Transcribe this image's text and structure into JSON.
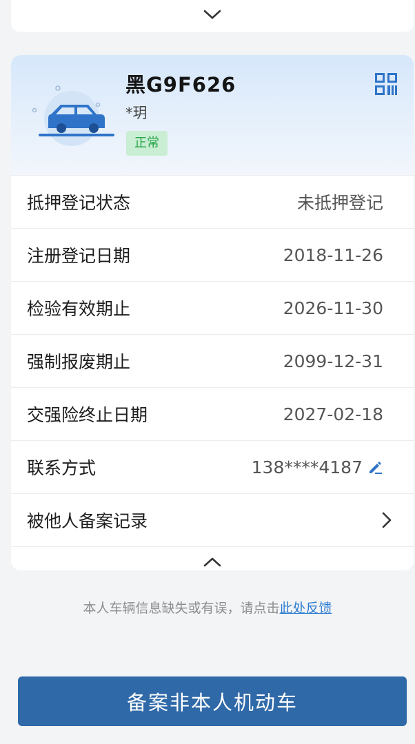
{
  "vehicle": {
    "plate": "黑G9F626",
    "owner": "*玥",
    "status": "正常"
  },
  "rows": [
    {
      "label": "抵押登记状态",
      "value": "未抵押登记"
    },
    {
      "label": "注册登记日期",
      "value": "2018-11-26"
    },
    {
      "label": "检验有效期止",
      "value": "2026-11-30"
    },
    {
      "label": "强制报废期止",
      "value": "2099-12-31"
    },
    {
      "label": "交强险终止日期",
      "value": "2027-02-18"
    },
    {
      "label": "联系方式",
      "value": "138****4187"
    },
    {
      "label": "被他人备案记录",
      "value": ""
    }
  ],
  "feedback": {
    "text": "本人车辆信息缺失或有误，请点击",
    "link": "此处反馈"
  },
  "primary_button": "备案非本人机动车",
  "colors": {
    "accent": "#2f69a8",
    "status_bg": "#c9eed3",
    "status_text": "#26a348",
    "link": "#2e7dd1"
  },
  "icons": {
    "expand": "chevron-down-icon",
    "collapse": "chevron-up-icon",
    "qr": "qr-code-icon",
    "edit": "edit-icon",
    "arrow": "chevron-right-icon",
    "car": "car-icon"
  }
}
